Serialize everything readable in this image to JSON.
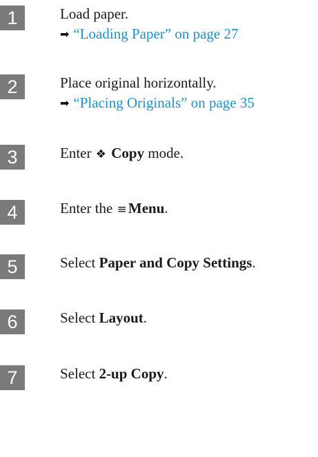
{
  "steps": [
    {
      "number": "1",
      "text": "Load paper.",
      "ref_arrow": "➡",
      "ref_link": "“Loading Paper” on page 27"
    },
    {
      "number": "2",
      "text": "Place original horizontally.",
      "ref_arrow": "➡",
      "ref_link": "“Placing Originals” on page 35"
    },
    {
      "number": "3",
      "prefix": "Enter",
      "icon_glyph": "❖",
      "icon_name": "copy-mode-icon",
      "bold": "Copy",
      "suffix": "mode."
    },
    {
      "number": "4",
      "prefix": "Enter the",
      "icon_glyph": "≡",
      "icon_name": "menu-icon",
      "bold": "Menu",
      "suffix": "."
    },
    {
      "number": "5",
      "prefix": "Select",
      "bold": "Paper and Copy Settings",
      "suffix": "."
    },
    {
      "number": "6",
      "prefix": "Select",
      "bold": "Layout",
      "suffix": "."
    },
    {
      "number": "7",
      "prefix": "Select",
      "bold": "2-up Copy",
      "suffix": "."
    }
  ],
  "colors": {
    "step_badge": "#7a7a7a",
    "link": "#1f8fc9"
  }
}
